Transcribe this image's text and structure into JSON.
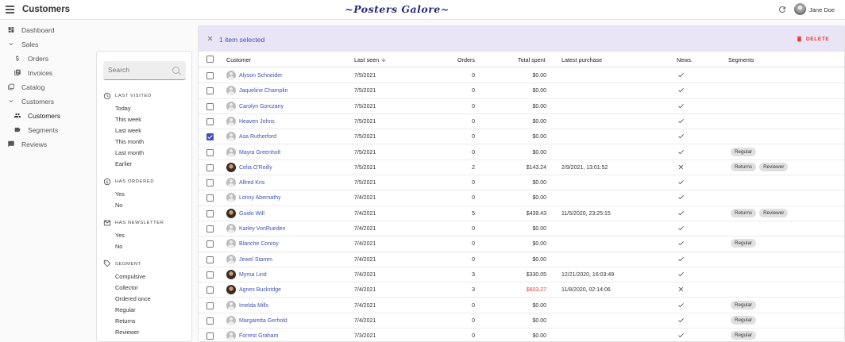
{
  "app": {
    "title": "Customers",
    "brand": "~Posters Galore~",
    "user_name": "Jane Doe"
  },
  "nav": {
    "items": [
      {
        "label": "Dashboard",
        "icon": "dashboard-icon"
      },
      {
        "label": "Sales",
        "icon": "chevron-down-icon"
      },
      {
        "label": "Orders",
        "icon": "dollar-icon"
      },
      {
        "label": "Invoices",
        "icon": "invoice-icon"
      },
      {
        "label": "Catalog",
        "icon": "catalog-icon"
      },
      {
        "label": "Customers",
        "icon": "chevron-down-icon"
      },
      {
        "label": "Customers",
        "icon": "people-icon"
      },
      {
        "label": "Segments",
        "icon": "label-icon"
      },
      {
        "label": "Reviews",
        "icon": "comment-icon"
      }
    ]
  },
  "filter": {
    "search_placeholder": "Search",
    "sections": [
      {
        "title": "LAST VISITED",
        "icon": "clock-icon",
        "options": [
          "Today",
          "This week",
          "Last week",
          "This month",
          "Last month",
          "Earlier"
        ]
      },
      {
        "title": "HAS ORDERED",
        "icon": "money-icon",
        "options": [
          "Yes",
          "No"
        ]
      },
      {
        "title": "HAS NEWSLETTER",
        "icon": "mail-icon",
        "options": [
          "Yes",
          "No"
        ]
      },
      {
        "title": "SEGMENT",
        "icon": "tag-icon",
        "options": [
          "Compulsive",
          "Collector",
          "Ordered once",
          "Regular",
          "Returns",
          "Reviewer"
        ]
      }
    ]
  },
  "list": {
    "selection_text": "1 item selected",
    "delete_label": "DELETE",
    "columns": {
      "customer": "Customer",
      "last_seen": "Last seen",
      "orders": "Orders",
      "total_spent": "Total spent",
      "latest_purchase": "Latest purchase",
      "news": "News.",
      "segments": "Segments"
    },
    "accent_color": "#3f51b5",
    "rows": [
      {
        "name": "Alyson Schneider",
        "last_seen": "7/5/2021",
        "orders": "0",
        "spent": "$0.00",
        "latest": "",
        "news": "check",
        "segments": [],
        "avatar": "default",
        "checked": false,
        "spent_red": false
      },
      {
        "name": "Jaqueline Champlin",
        "last_seen": "7/5/2021",
        "orders": "0",
        "spent": "$0.00",
        "latest": "",
        "news": "check",
        "segments": [],
        "avatar": "default",
        "checked": false,
        "spent_red": false
      },
      {
        "name": "Carolyn Gorczany",
        "last_seen": "7/5/2021",
        "orders": "0",
        "spent": "$0.00",
        "latest": "",
        "news": "check",
        "segments": [],
        "avatar": "default",
        "checked": false,
        "spent_red": false
      },
      {
        "name": "Heaven Johns",
        "last_seen": "7/5/2021",
        "orders": "0",
        "spent": "$0.00",
        "latest": "",
        "news": "check",
        "segments": [],
        "avatar": "default",
        "checked": false,
        "spent_red": false
      },
      {
        "name": "Asa Rutherford",
        "last_seen": "7/5/2021",
        "orders": "0",
        "spent": "$0.00",
        "latest": "",
        "news": "check",
        "segments": [],
        "avatar": "default",
        "checked": true,
        "spent_red": false
      },
      {
        "name": "Mayra Greenholt",
        "last_seen": "7/5/2021",
        "orders": "0",
        "spent": "$0.00",
        "latest": "",
        "news": "check",
        "segments": [
          "Regular"
        ],
        "avatar": "default",
        "checked": false,
        "spent_red": false
      },
      {
        "name": "Celia O'Reilly",
        "last_seen": "7/5/2021",
        "orders": "2",
        "spent": "$143.24",
        "latest": "2/9/2021, 13:01:52",
        "news": "cross",
        "segments": [
          "Returns",
          "Reviewer"
        ],
        "avatar": "photo",
        "checked": false,
        "spent_red": false
      },
      {
        "name": "Alfred Kris",
        "last_seen": "7/5/2021",
        "orders": "0",
        "spent": "$0.00",
        "latest": "",
        "news": "check",
        "segments": [],
        "avatar": "default",
        "checked": false,
        "spent_red": false
      },
      {
        "name": "Lonny Abernathy",
        "last_seen": "7/4/2021",
        "orders": "0",
        "spent": "$0.00",
        "latest": "",
        "news": "check",
        "segments": [],
        "avatar": "default",
        "checked": false,
        "spent_red": false
      },
      {
        "name": "Guido Will",
        "last_seen": "7/4/2021",
        "orders": "5",
        "spent": "$439.43",
        "latest": "11/5/2020, 23:25:15",
        "news": "check",
        "segments": [
          "Returns",
          "Reviewer"
        ],
        "avatar": "photo",
        "checked": false,
        "spent_red": false
      },
      {
        "name": "Karley VonRueden",
        "last_seen": "7/4/2021",
        "orders": "0",
        "spent": "$0.00",
        "latest": "",
        "news": "check",
        "segments": [],
        "avatar": "default",
        "checked": false,
        "spent_red": false
      },
      {
        "name": "Blanche Conroy",
        "last_seen": "7/4/2021",
        "orders": "0",
        "spent": "$0.00",
        "latest": "",
        "news": "check",
        "segments": [
          "Regular"
        ],
        "avatar": "default",
        "checked": false,
        "spent_red": false
      },
      {
        "name": "Jewel Stamm",
        "last_seen": "7/4/2021",
        "orders": "0",
        "spent": "$0.00",
        "latest": "",
        "news": "check",
        "segments": [],
        "avatar": "default",
        "checked": false,
        "spent_red": false
      },
      {
        "name": "Myrna Lind",
        "last_seen": "7/4/2021",
        "orders": "3",
        "spent": "$330.05",
        "latest": "12/21/2020, 16:03:49",
        "news": "check",
        "segments": [],
        "avatar": "photo",
        "checked": false,
        "spent_red": false
      },
      {
        "name": "Agnes Buckridge",
        "last_seen": "7/4/2021",
        "orders": "3",
        "spent": "$603.27",
        "latest": "11/8/2020, 02:14:06",
        "news": "cross",
        "segments": [],
        "avatar": "photo",
        "checked": false,
        "spent_red": true
      },
      {
        "name": "Imelda Mills",
        "last_seen": "7/4/2021",
        "orders": "0",
        "spent": "$0.00",
        "latest": "",
        "news": "check",
        "segments": [
          "Regular"
        ],
        "avatar": "default",
        "checked": false,
        "spent_red": false
      },
      {
        "name": "Margaretta Gerhold",
        "last_seen": "7/4/2021",
        "orders": "0",
        "spent": "$0.00",
        "latest": "",
        "news": "check",
        "segments": [
          "Regular"
        ],
        "avatar": "default",
        "checked": false,
        "spent_red": false
      },
      {
        "name": "Forrest Graham",
        "last_seen": "7/3/2021",
        "orders": "0",
        "spent": "$0.00",
        "latest": "",
        "news": "check",
        "segments": [
          "Regular"
        ],
        "avatar": "default",
        "checked": false,
        "spent_red": false
      }
    ]
  }
}
